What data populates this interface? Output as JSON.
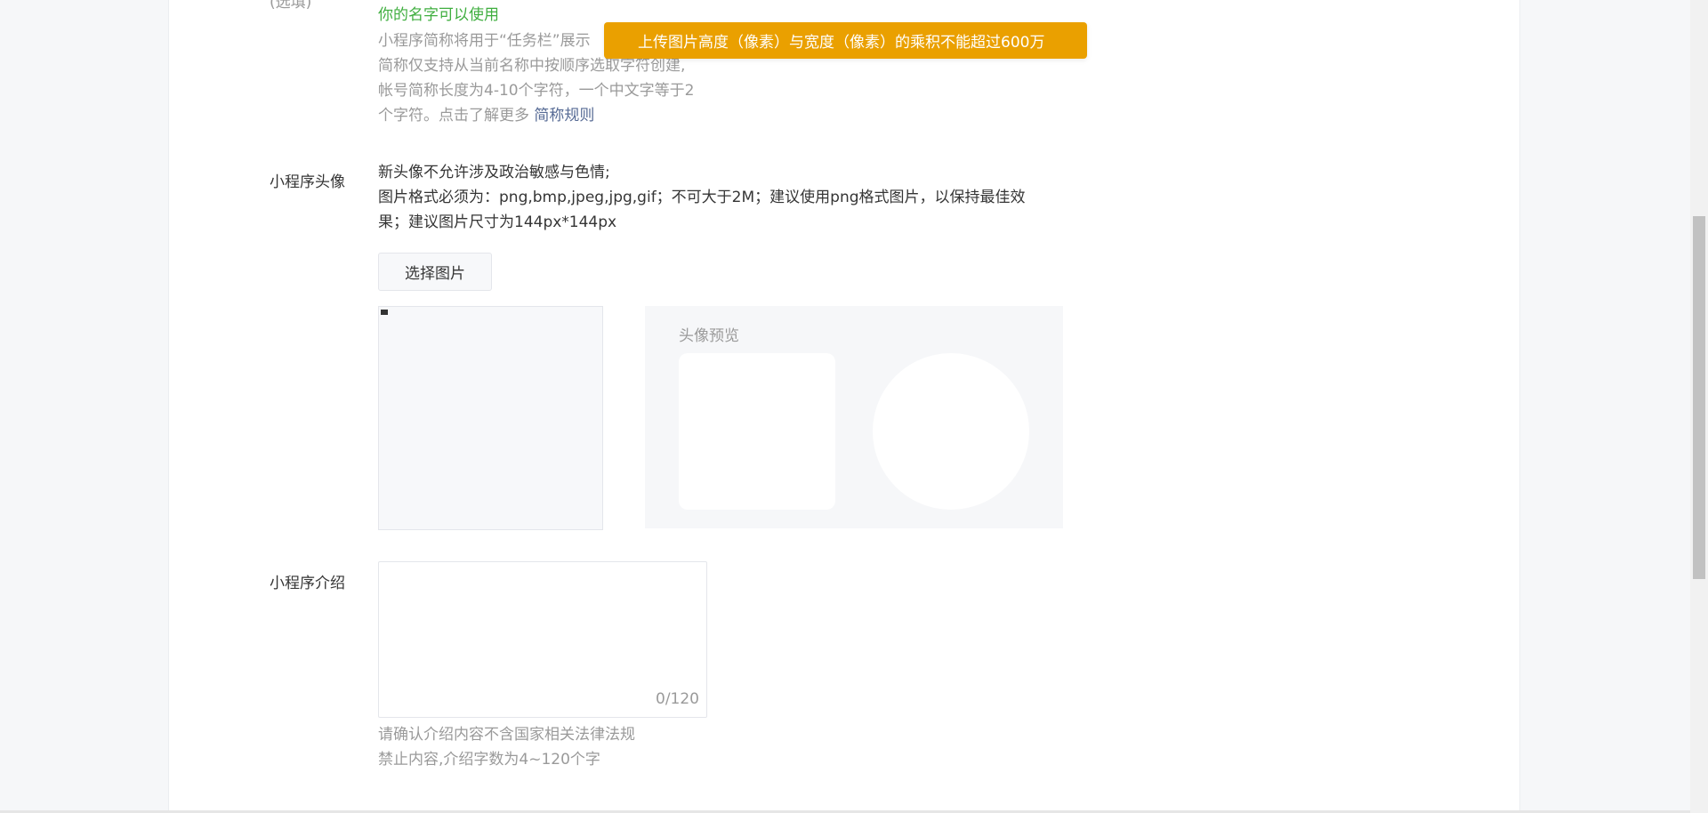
{
  "name_section": {
    "label_partial": "(选填)",
    "status": "你的名字可以使用",
    "hint_lines": [
      "小程序简称将用于“任务栏”展示",
      "简称仅支持从当前名称中按顺序选取字符创建,",
      "帐号简称长度为4-10个字符，一个中文字等于2",
      "个字符。点击了解更多"
    ],
    "rule_link": "简称规则"
  },
  "avatar_section": {
    "label": "小程序头像",
    "desc_line1": "新头像不允许涉及政治敏感与色情;",
    "desc_line2": "图片格式必须为：png,bmp,jpeg,jpg,gif；不可大于2M；建议使用png格式图片，以保持最佳效",
    "desc_line3": "果；建议图片尺寸为144px*144px",
    "choose_button": "选择图片",
    "preview_title": "头像预览"
  },
  "intro_section": {
    "label": "小程序介绍",
    "value": "",
    "counter": "0/120",
    "hint_line1": "请确认介绍内容不含国家相关法律法规",
    "hint_line2": "禁止内容,介绍字数为4~120个字"
  },
  "toast": {
    "message": "上传图片高度（像素）与宽度（像素）的乘积不能超过600万"
  },
  "colors": {
    "toast_bg": "#eaa000",
    "success_green": "#3fae3f",
    "link_blue": "#576b95"
  }
}
